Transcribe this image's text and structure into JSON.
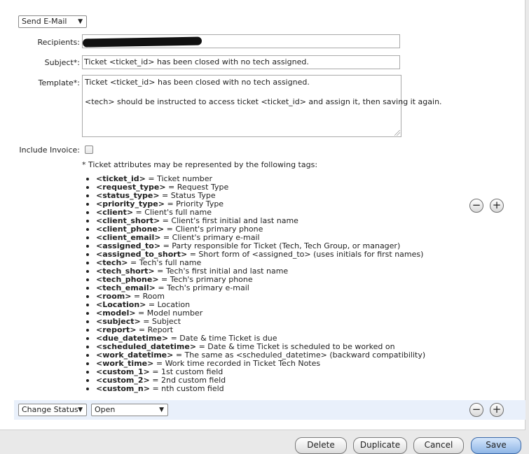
{
  "action_select": {
    "value": "Send E-Mail"
  },
  "form": {
    "recipients_label": "Recipients:",
    "subject_label": "Subject*:",
    "subject_value": "Ticket <ticket_id> has been closed with no tech assigned.",
    "template_label": "Template*:",
    "template_line1": "Ticket <ticket_id> has been closed with no tech assigned.",
    "template_line2": "<tech> should be instructed to access ticket <ticket_id> and assign it, then saving it again.",
    "include_invoice_label": "Include Invoice:",
    "include_invoice_checked": false
  },
  "tags_note": "* Ticket attributes may be represented by the following tags:",
  "tags": [
    {
      "tag": "<ticket_id>",
      "desc": " = Ticket number"
    },
    {
      "tag": "<request_type>",
      "desc": " = Request Type"
    },
    {
      "tag": "<status_type>",
      "desc": " = Status Type"
    },
    {
      "tag": "<priority_type>",
      "desc": " = Priority Type"
    },
    {
      "tag": "<client>",
      "desc": " = Client's full name"
    },
    {
      "tag": "<client_short>",
      "desc": " = Client's first initial and last name"
    },
    {
      "tag": "<client_phone>",
      "desc": " = Client's primary phone"
    },
    {
      "tag": "<client_email>",
      "desc": " = Client's primary e-mail"
    },
    {
      "tag": "<assigned_to>",
      "desc": " = Party responsible for Ticket (Tech, Tech Group, or manager)"
    },
    {
      "tag": "<assigned_to_short>",
      "desc": " = Short form of <assigned_to> (uses initials for first names)"
    },
    {
      "tag": "<tech>",
      "desc": " = Tech's full name"
    },
    {
      "tag": "<tech_short>",
      "desc": " = Tech's first initial and last name"
    },
    {
      "tag": "<tech_phone>",
      "desc": " = Tech's primary phone"
    },
    {
      "tag": "<tech_email>",
      "desc": " = Tech's primary e-mail"
    },
    {
      "tag": "<room>",
      "desc": " = Room"
    },
    {
      "tag": "<Location>",
      "desc": " = Location"
    },
    {
      "tag": "<model>",
      "desc": " = Model number"
    },
    {
      "tag": "<subject>",
      "desc": " = Subject"
    },
    {
      "tag": "<report>",
      "desc": " = Report"
    },
    {
      "tag": "<due_datetime>",
      "desc": " = Date & time Ticket is due"
    },
    {
      "tag": "<scheduled_datetime>",
      "desc": " = Date & time Ticket is scheduled to be worked on"
    },
    {
      "tag": "<work_datetime>",
      "desc": " = The same as <scheduled_datetime> (backward compatibility)"
    },
    {
      "tag": "<work_time>",
      "desc": " = Work time recorded in Ticket Tech Notes"
    },
    {
      "tag": "<custom_1>",
      "desc": " = 1st custom field"
    },
    {
      "tag": "<custom_2>",
      "desc": " = 2nd custom field"
    },
    {
      "tag": "<custom_n>",
      "desc": " = nth custom field"
    }
  ],
  "row_controls": {
    "remove": "−",
    "add": "+"
  },
  "status_action": {
    "action_value": "Change Status",
    "status_value": "Open"
  },
  "footer": {
    "delete": "Delete",
    "duplicate": "Duplicate",
    "cancel": "Cancel",
    "save": "Save"
  }
}
